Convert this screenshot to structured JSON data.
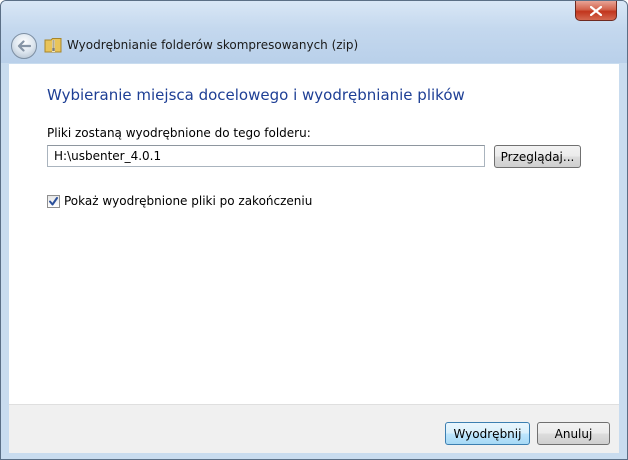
{
  "window": {
    "title": "Wyodrębnianie folderów skompresowanych (zip)"
  },
  "content": {
    "heading": "Wybieranie miejsca docelowego i wyodrębnianie plików",
    "dest_label": "Pliki zostaną wyodrębnione do tego folderu:",
    "path_value": "H:\\usbenter_4.0.1",
    "browse_label": "Przeglądaj...",
    "show_files_label": "Pokaż wyodrębnione pliki po zakończeniu",
    "show_files_checked": true
  },
  "footer": {
    "extract_label": "Wyodrębnij",
    "cancel_label": "Anuluj"
  },
  "icons": {
    "close": "close-icon",
    "back": "back-arrow-icon",
    "folder": "zip-folder-icon",
    "check": "checkmark-icon"
  },
  "colors": {
    "heading": "#1e3f95",
    "titlebar": "#c4d8ee",
    "close_button": "#c2351d"
  }
}
